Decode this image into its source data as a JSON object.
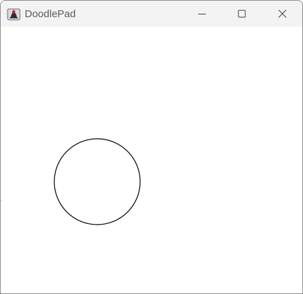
{
  "window": {
    "title": "DoodlePad",
    "icon": "java-duke-icon",
    "caption_buttons": [
      "minimize-icon",
      "maximize-icon",
      "close-icon"
    ]
  },
  "canvas": {
    "background": "#ffffff",
    "shapes": [
      {
        "type": "circle",
        "fill": "none",
        "stroke": "#000000"
      }
    ]
  },
  "colors": {
    "titlebar": "#f3f3f3",
    "title_text": "#5b5b5b",
    "icon_stroke": "#3c3c3c"
  }
}
